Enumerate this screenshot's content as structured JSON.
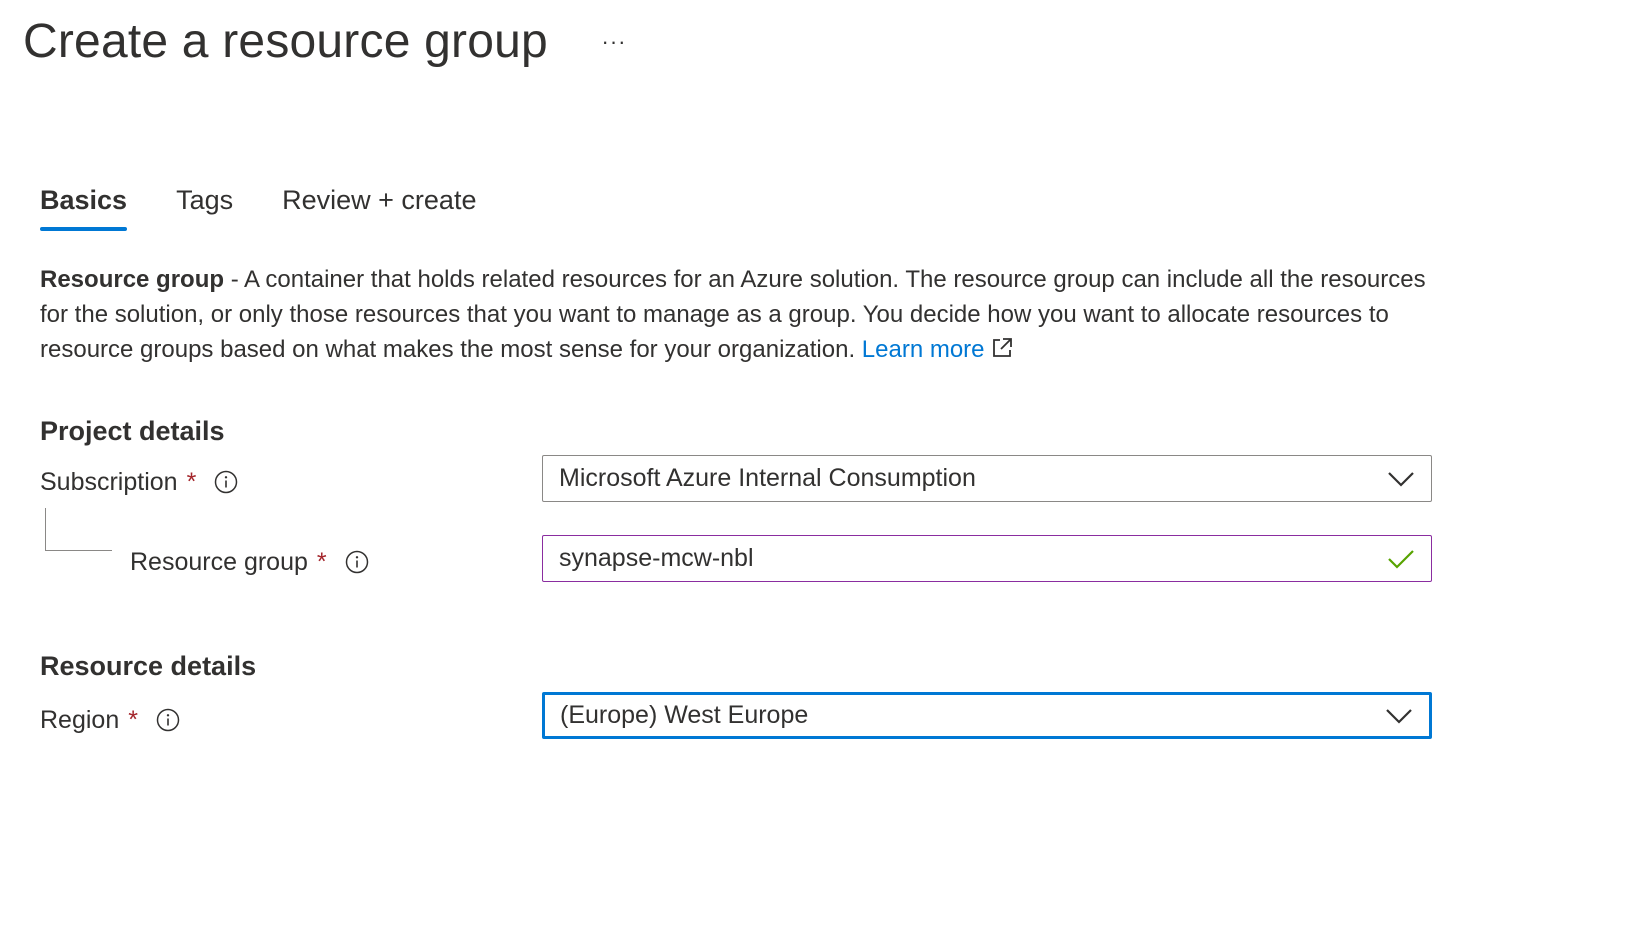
{
  "header": {
    "title": "Create a resource group",
    "more_label": "···"
  },
  "tabs": [
    {
      "label": "Basics",
      "active": true
    },
    {
      "label": "Tags",
      "active": false
    },
    {
      "label": "Review + create",
      "active": false
    }
  ],
  "description": {
    "strong": "Resource group",
    "text": " - A container that holds related resources for an Azure solution. The resource group can include all the resources for the solution, or only those resources that you want to manage as a group. You decide how you want to allocate resources to resource groups based on what makes the most sense for your organization. ",
    "link": "Learn more",
    "link_icon": "external-link-icon"
  },
  "project_details": {
    "heading": "Project details",
    "subscription": {
      "label": "Subscription",
      "required_marker": "*",
      "info_icon": "info-icon",
      "value": "Microsoft Azure Internal Consumption",
      "dropdown_icon": "chevron-down-icon"
    },
    "resource_group": {
      "label": "Resource group",
      "required_marker": "*",
      "info_icon": "info-icon",
      "value": "synapse-mcw-nbl",
      "valid_icon": "checkmark-icon"
    }
  },
  "resource_details": {
    "heading": "Resource details",
    "region": {
      "label": "Region",
      "required_marker": "*",
      "info_icon": "info-icon",
      "value": "(Europe) West Europe",
      "dropdown_icon": "chevron-down-icon"
    }
  },
  "colors": {
    "accent": "#0078d4",
    "required": "#a4262c",
    "valid": "#57a300",
    "input_border_active": "#8a2da0",
    "text": "#323130"
  }
}
